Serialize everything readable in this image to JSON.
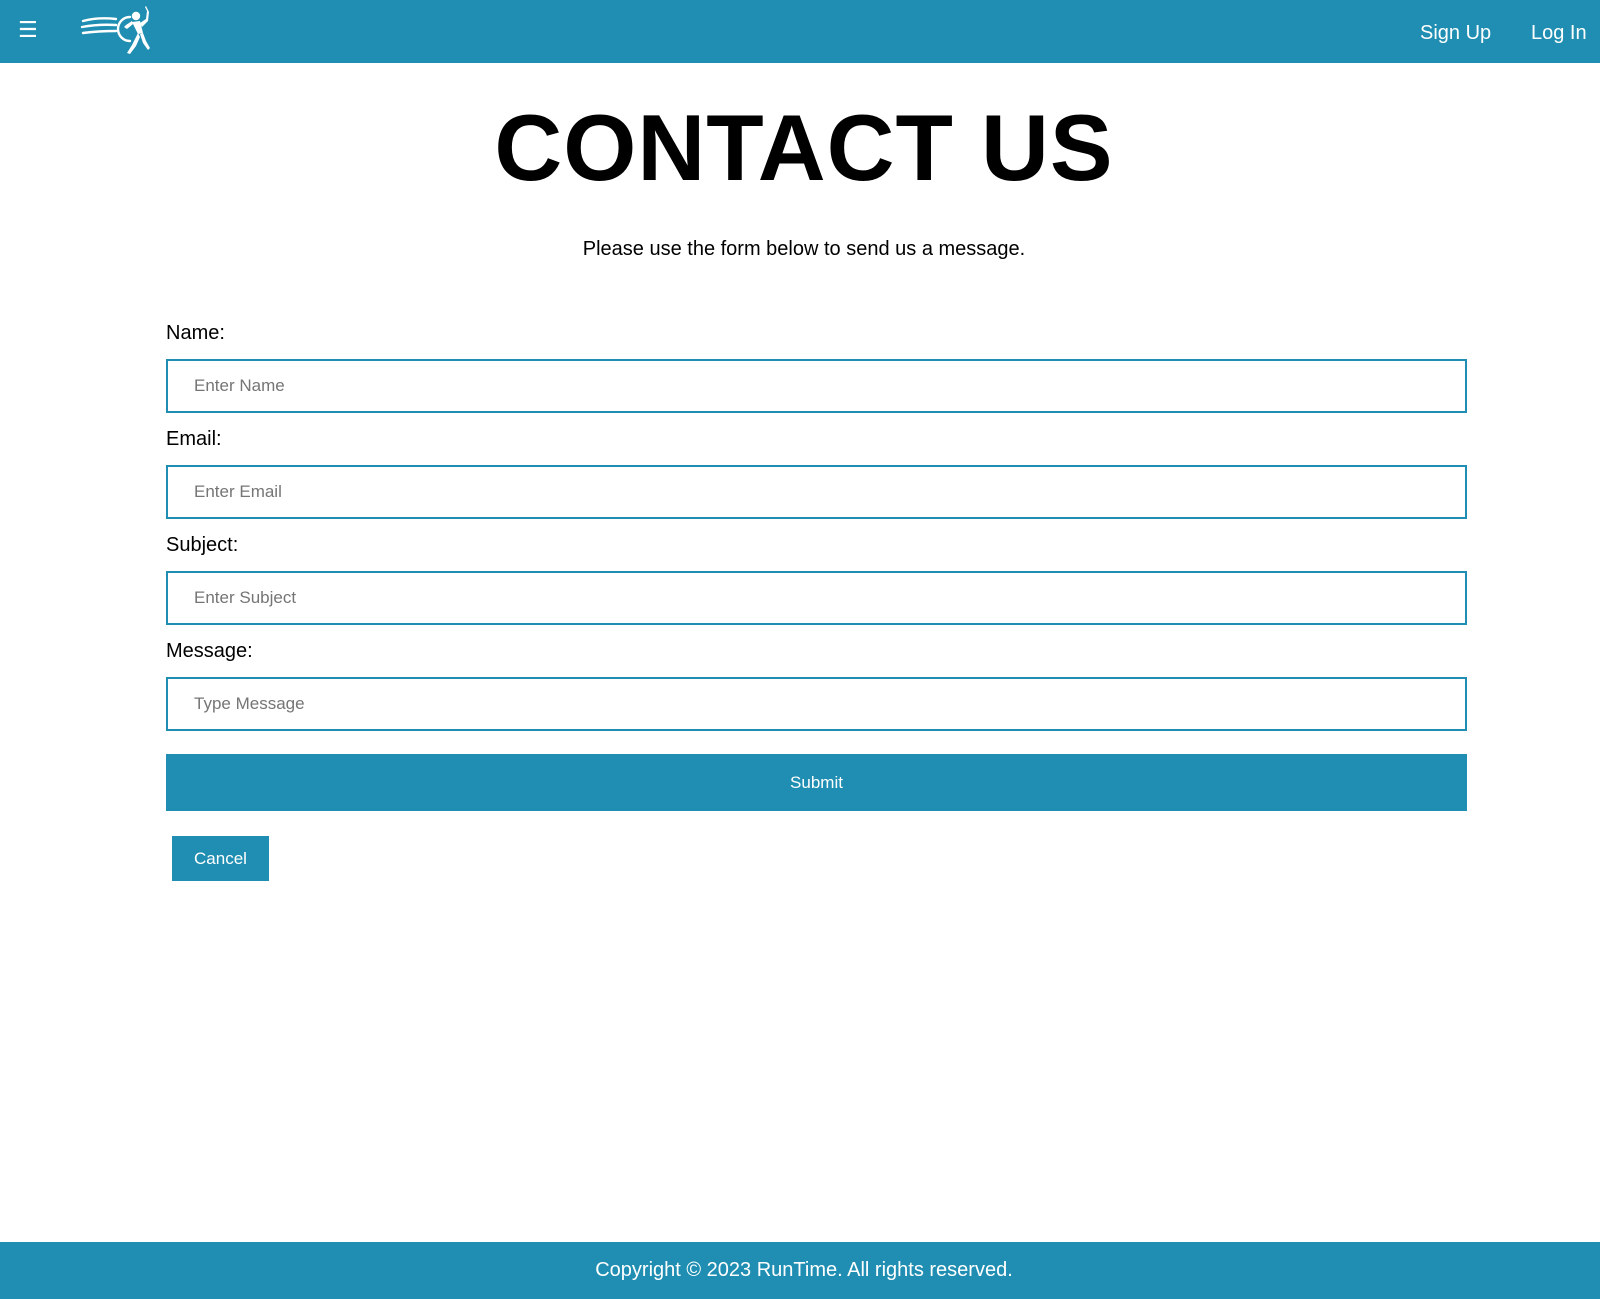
{
  "header": {
    "menu_icon": "☰",
    "logo_name": "runner-logo-icon",
    "sign_up_label": "Sign Up",
    "log_in_label": "Log In"
  },
  "main": {
    "title": "CONTACT US",
    "subtitle": "Please use the form below to send us a message.",
    "form": {
      "name_label": "Name:",
      "name_placeholder": "Enter Name",
      "email_label": "Email:",
      "email_placeholder": "Enter Email",
      "subject_label": "Subject:",
      "subject_placeholder": "Enter Subject",
      "message_label": "Message:",
      "message_placeholder": "Type Message",
      "submit_label": "Submit",
      "cancel_label": "Cancel"
    }
  },
  "footer": {
    "copyright": "Copyright © 2023 RunTime. All rights reserved."
  },
  "colors": {
    "brand": "#1f8eb2",
    "text": "#000000",
    "on_brand": "#ffffff"
  }
}
